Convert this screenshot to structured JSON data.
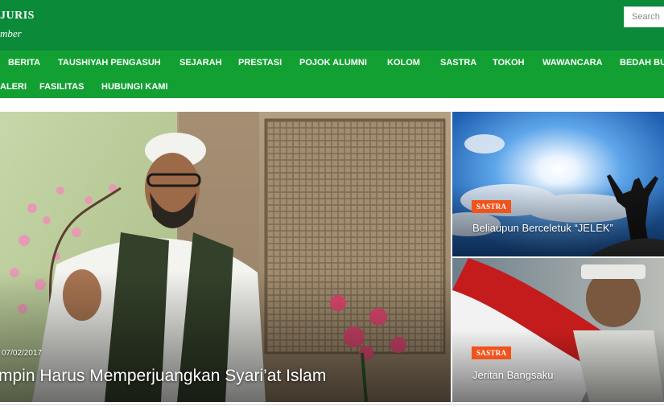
{
  "header": {
    "logo_top": "JURIS",
    "logo_bottom": "mber",
    "search_placeholder": "Search"
  },
  "nav": {
    "row1": [
      "BERITA",
      "TAUSHIYAH PENGASUH",
      "SEJARAH",
      "PRESTASI",
      "POJOK ALUMNI",
      "KOLOM",
      "SASTRA",
      "TOKOH",
      "WAWANCARA",
      "BEDAH BU"
    ],
    "row2": [
      "ALERI",
      "FASILITAS",
      "HUBUNGI KAMI"
    ]
  },
  "featured": {
    "date": "07/02/2017",
    "title": "mpin Harus Memperjuangkan Syari’at Islam"
  },
  "side_posts": [
    {
      "category": "SASTRA",
      "title": "Beliaupun Berceletuk “JELEK”"
    },
    {
      "category": "SASTRA",
      "title": "Jeritan Bangsaku"
    }
  ],
  "colors": {
    "header_green": "#0b8a3a",
    "nav_green": "#13a033",
    "badge_orange": "#f0531b"
  }
}
